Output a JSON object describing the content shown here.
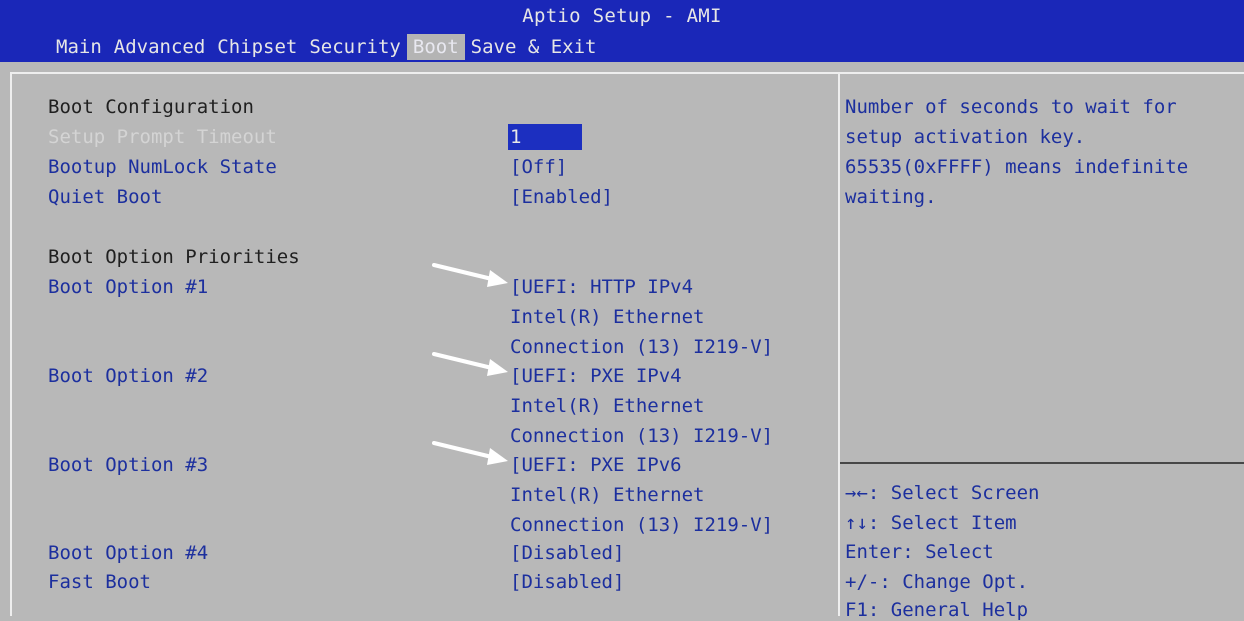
{
  "window": {
    "title": "Aptio Setup - AMI"
  },
  "menu": [
    {
      "label": "Main"
    },
    {
      "label": "Advanced"
    },
    {
      "label": "Chipset"
    },
    {
      "label": "Security"
    },
    {
      "label": "Boot"
    },
    {
      "label": "Save & Exit"
    }
  ],
  "boot": {
    "section_config": "Boot Configuration",
    "setup_prompt_timeout": {
      "label": "Setup Prompt Timeout",
      "value": "1"
    },
    "bootup_numlock": {
      "label": "Bootup NumLock State",
      "value": "[Off]"
    },
    "quiet_boot": {
      "label": "Quiet Boot",
      "value": "[Enabled]"
    },
    "section_priorities": "Boot Option Priorities",
    "options": [
      {
        "label": "Boot Option #1",
        "lines": [
          "[UEFI: HTTP IPv4",
          "Intel(R) Ethernet",
          "Connection (13) I219-V]"
        ]
      },
      {
        "label": "Boot Option #2",
        "lines": [
          "[UEFI: PXE IPv4",
          "Intel(R) Ethernet",
          "Connection (13) I219-V]"
        ]
      },
      {
        "label": "Boot Option #3",
        "lines": [
          "[UEFI: PXE IPv6",
          "Intel(R) Ethernet",
          "Connection (13) I219-V]"
        ]
      },
      {
        "label": "Boot Option #4",
        "lines": [
          "[Disabled]"
        ]
      }
    ],
    "fast_boot": {
      "label": "Fast Boot",
      "value": "[Disabled]"
    }
  },
  "help": {
    "description": [
      "Number of seconds to wait for",
      "setup activation key.",
      "65535(0xFFFF) means indefinite",
      "waiting."
    ],
    "keys": [
      "→←: Select Screen",
      "↑↓: Select Item",
      "Enter: Select",
      "+/-: Change Opt.",
      "F1: General Help"
    ]
  },
  "colors": {
    "header_bg": "#1a27b8",
    "panel_bg": "#b8b8b8",
    "text_blue": "#1c2f9e",
    "highlight": "#1c2fc0",
    "annotation_arrow": "#ffffff"
  }
}
